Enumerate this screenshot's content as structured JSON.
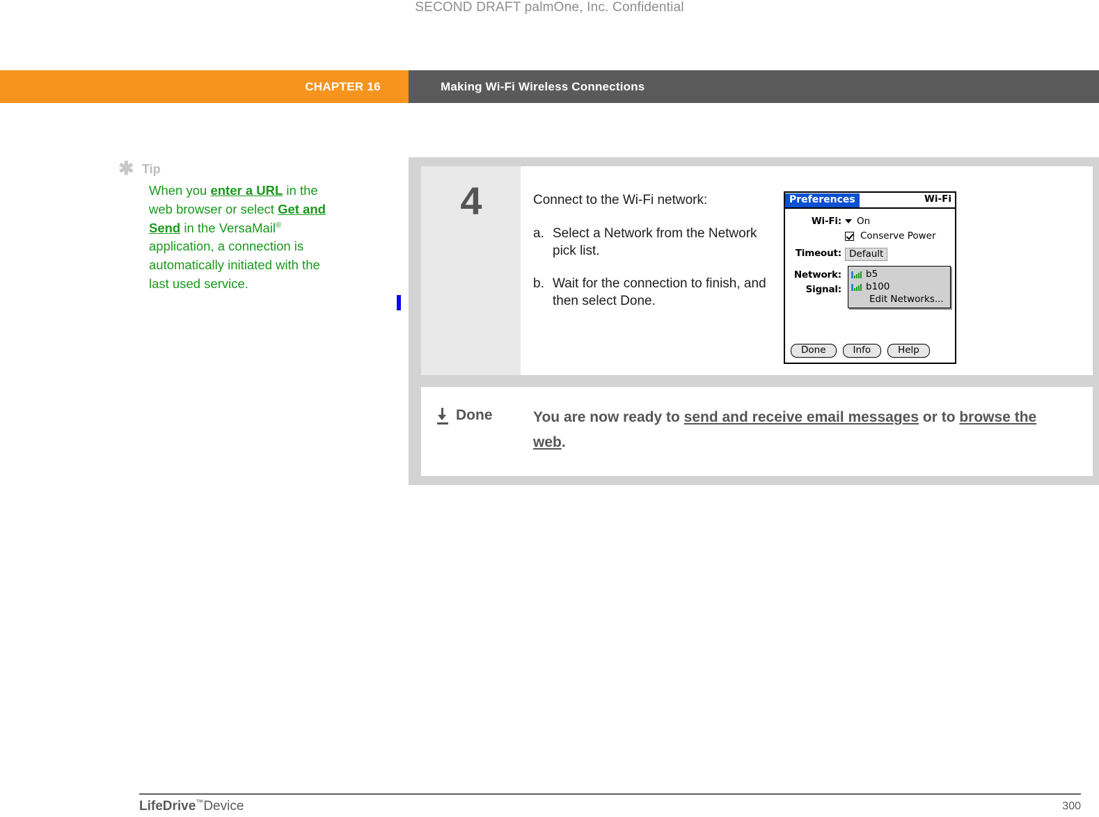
{
  "draft_notice": "SECOND DRAFT palmOne, Inc.  Confidential",
  "header": {
    "chapter_label": "CHAPTER 16",
    "chapter_title": "Making Wi-Fi Wireless Connections",
    "accent_color": "#f7941e",
    "title_bg_color": "#5a5a5a"
  },
  "tip": {
    "icon": "asterisk-icon",
    "title": "Tip",
    "text_color": "#18991b",
    "parts": [
      {
        "type": "text",
        "value": "When you "
      },
      {
        "type": "link",
        "value": "enter a URL"
      },
      {
        "type": "text",
        "value": " in the web browser or select "
      },
      {
        "type": "link",
        "value": "Get and Send"
      },
      {
        "type": "text",
        "value": " in the VersaMail"
      },
      {
        "type": "sup",
        "value": "®"
      },
      {
        "type": "text",
        "value": " application, a connection is automatically initiated with the last used service."
      }
    ],
    "line1_a": "When you ",
    "line1_link": "enter a URL",
    "line1_b": " in",
    "line2": "the web browser or select",
    "line3_link": "Get and Send",
    "line3_b": " in the",
    "line4_a": "VersaMail",
    "line4_sup": "®",
    "line4_b": " application,",
    "line5": "a connection is",
    "line6": "automatically initiated",
    "line7": "with the last used service."
  },
  "change_bar_color": "#0b0bf0",
  "step": {
    "number": "4",
    "lead": "Connect to the Wi-Fi network:",
    "substeps": [
      {
        "marker": "a.",
        "text": "Select a Network from the Network pick list."
      },
      {
        "marker": "b.",
        "text": "Wait for the connection to finish, and then select Done."
      }
    ]
  },
  "palm_screen": {
    "app_title": "Preferences",
    "panel_title": "Wi-Fi",
    "title_bg": "#0a50d0",
    "rows": [
      {
        "label": "Wi-Fi:",
        "value": "On",
        "control": "dropdown-trigger"
      },
      {
        "label": "",
        "value": "Conserve Power",
        "control": "checkbox-checked"
      },
      {
        "label": "Timeout:",
        "value": "Default",
        "control": "text-field"
      },
      {
        "label": "Network:",
        "value": "",
        "control": "pick-list"
      },
      {
        "label": "Signal:",
        "value": "",
        "control": "static"
      }
    ],
    "wifi_label": "Wi-Fi:",
    "wifi_value": "On",
    "conserve_power_label": "Conserve Power",
    "timeout_label": "Timeout:",
    "timeout_value": "Default",
    "network_label": "Network:",
    "signal_label": "Signal:",
    "picklist": {
      "items": [
        {
          "icon": "signal-strength-icon",
          "label": "b5"
        },
        {
          "icon": "signal-strength-icon",
          "label": "b100"
        }
      ],
      "edit_label": "Edit Networks..."
    },
    "buttons": [
      {
        "label": "Done"
      },
      {
        "label": "Info"
      },
      {
        "label": "Help"
      }
    ]
  },
  "done_section": {
    "icon": "down-arrow-to-bar-icon",
    "label": "Done",
    "text_a": "You are now ready to ",
    "link_1": "send and receive email messages",
    "text_b": " or to ",
    "link_2": "browse the web",
    "text_c": "."
  },
  "footer": {
    "product_bold": "LifeDrive",
    "product_sup": "™",
    "product_rest": "Device",
    "page_number": "300"
  }
}
